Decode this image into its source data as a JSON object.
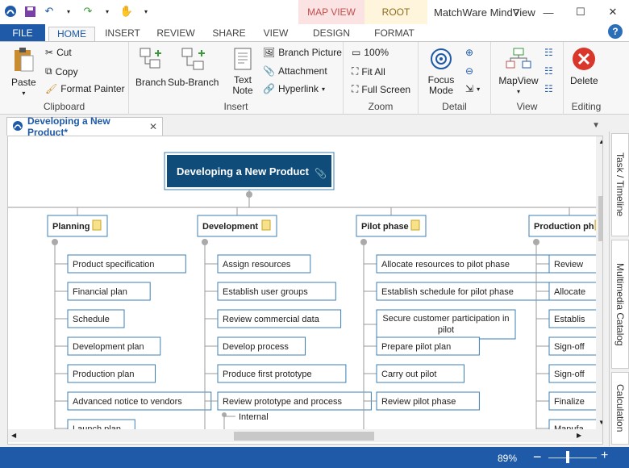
{
  "app_title": "MatchWare MindView",
  "context_groups": {
    "map_view": "MAP VIEW",
    "root": "ROOT"
  },
  "tabs": {
    "file": "FILE",
    "home": "HOME",
    "insert": "INSERT",
    "review": "REVIEW",
    "share": "SHARE",
    "view": "VIEW",
    "design": "DESIGN",
    "format": "FORMAT"
  },
  "help": "?",
  "ribbon": {
    "clipboard": {
      "label": "Clipboard",
      "paste": "Paste",
      "cut": "Cut",
      "copy": "Copy",
      "format_painter": "Format Painter"
    },
    "insert": {
      "label": "Insert",
      "branch": "Branch",
      "sub_branch": "Sub-Branch",
      "text_note": "Text Note",
      "branch_picture": "Branch Picture",
      "attachment": "Attachment",
      "hyperlink": "Hyperlink"
    },
    "zoom": {
      "label": "Zoom",
      "pct100": "100%",
      "fit_all": "Fit All",
      "full_screen": "Full Screen"
    },
    "detail": {
      "label": "Detail",
      "focus_mode": "Focus Mode"
    },
    "view": {
      "label": "View",
      "mapview": "MapView"
    },
    "editing": {
      "label": "Editing",
      "delete": "Delete"
    }
  },
  "document_tab": "Developing a New Product*",
  "map": {
    "root": "Developing a New Product",
    "branches": [
      {
        "name": "Planning",
        "items": [
          "Product specification",
          "Financial plan",
          "Schedule",
          "Development plan",
          "Production plan",
          "Advanced notice to vendors",
          "Launch plan"
        ]
      },
      {
        "name": "Development",
        "items": [
          "Assign resources",
          "Establish user groups",
          "Review commercial data",
          "Develop process",
          "Produce first prototype",
          "Review prototype and process"
        ],
        "sub_items": [
          "Internal"
        ]
      },
      {
        "name": "Pilot phase",
        "items": [
          "Allocate resources to pilot phase",
          "Establish schedule for pilot phase",
          "Secure customer participation in pilot",
          "Prepare pilot plan",
          "Carry out pilot",
          "Review pilot phase"
        ]
      },
      {
        "name": "Production ph",
        "items": [
          "Review",
          "Allocate",
          "Establis",
          "Sign-off",
          "Sign-off",
          "Finalize",
          "Manufa"
        ]
      }
    ]
  },
  "side_tabs": [
    "Task / Timeline",
    "Multimedia Catalog",
    "Calculation"
  ],
  "status": {
    "zoom": "89%"
  },
  "colors": {
    "accent": "#1e5aa8",
    "root_fill": "#0f4c7a",
    "branch_border": "#3b7fb5"
  }
}
